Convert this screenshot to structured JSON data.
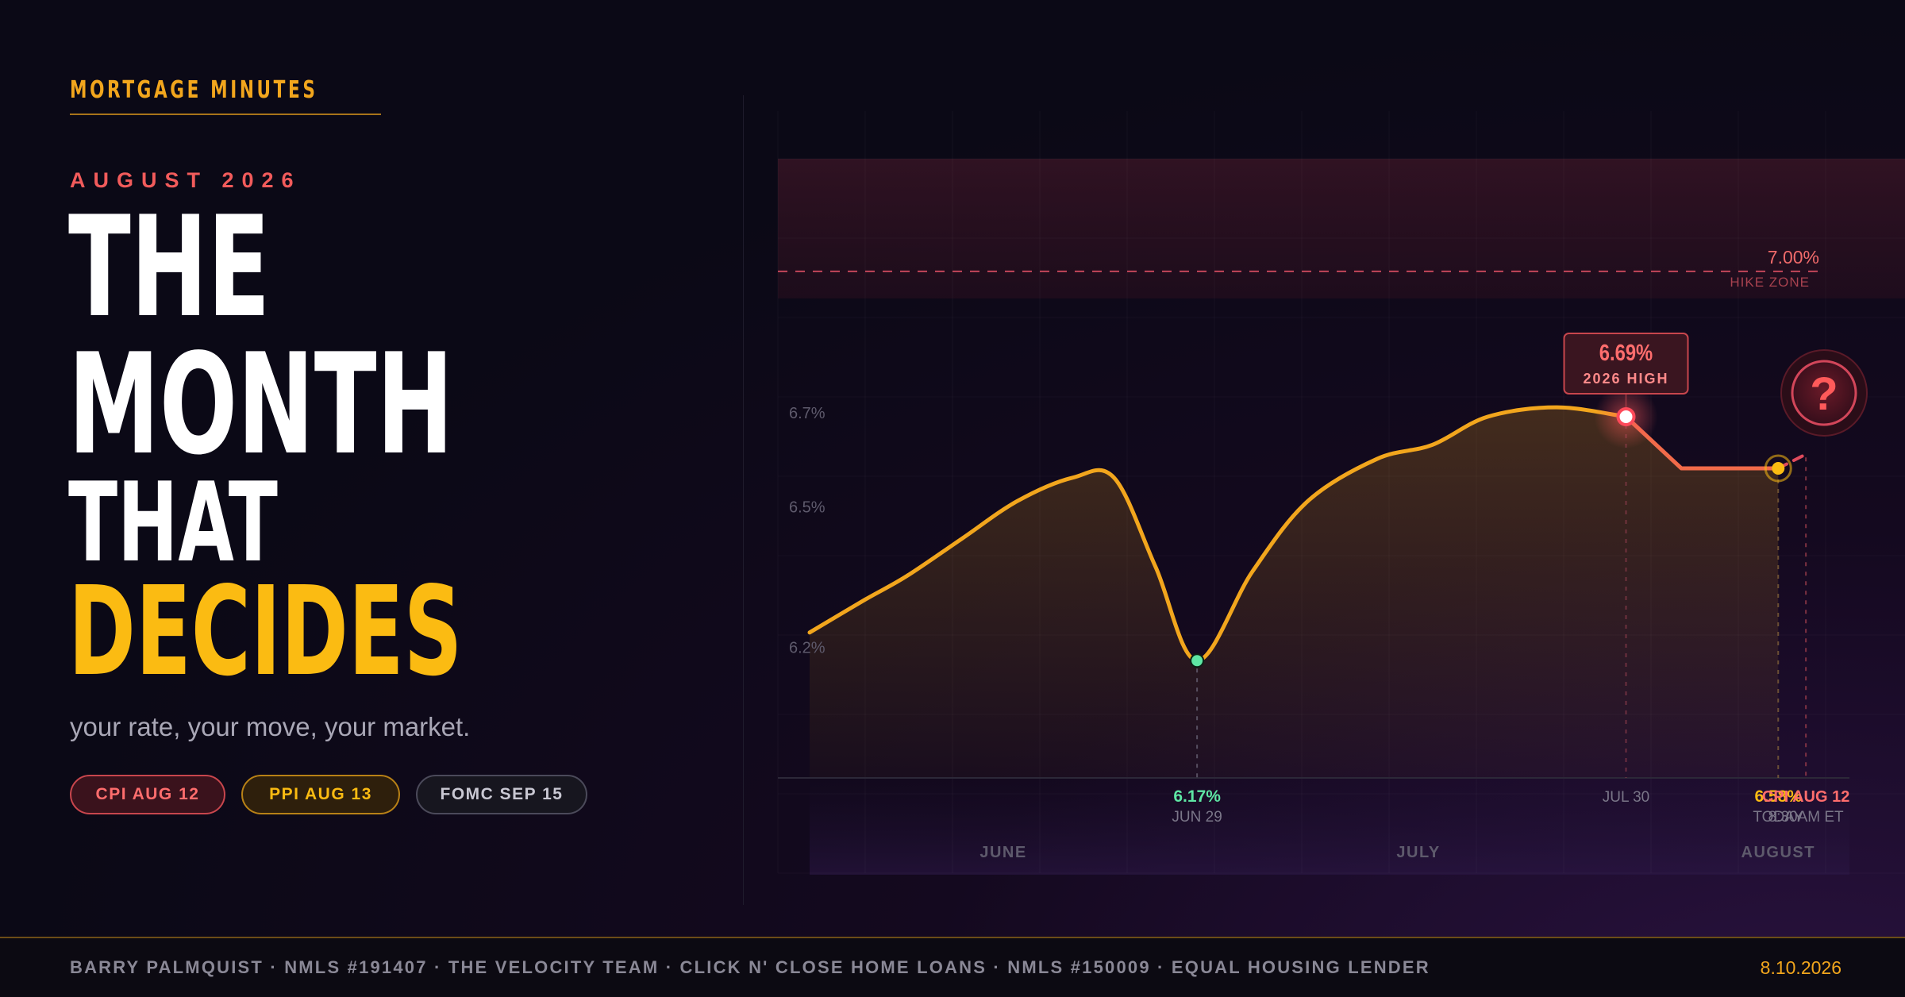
{
  "brand": "MORTGAGE MINUTES",
  "kicker": "AUGUST 2026",
  "headline": {
    "line1": "THE",
    "line2": "MONTH",
    "line3": "THAT",
    "line4": "DECIDES"
  },
  "subtitle": "your rate, your move, your market.",
  "pills": [
    {
      "label": "CPI AUG 12",
      "color": "#ff6d6d"
    },
    {
      "label": "PPI AUG 13",
      "color": "#fbbb12"
    },
    {
      "label": "FOMC SEP 15",
      "color": "#c9c8d3"
    }
  ],
  "footer": {
    "credits": "BARRY PALMQUIST · NMLS #191407 · THE VELOCITY TEAM · CLICK N' CLOSE HOME LOANS · NMLS #150009 · EQUAL HOUSING LENDER",
    "date": "8.10.2026"
  },
  "chart_data": {
    "type": "line",
    "x_range": [
      "2026-06-01",
      "2026-08-14"
    ],
    "y_range": [
      5.92,
      7.24
    ],
    "series": [
      {
        "values": [
          {
            "x": "2026-06-01",
            "y": 6.23
          },
          {
            "x": "2026-06-05",
            "y": 6.3
          },
          {
            "x": "2026-06-08",
            "y": 6.35
          },
          {
            "x": "2026-06-12",
            "y": 6.43
          },
          {
            "x": "2026-06-16",
            "y": 6.51
          },
          {
            "x": "2026-06-20",
            "y": 6.56
          },
          {
            "x": "2026-06-23",
            "y": 6.56
          },
          {
            "x": "2026-06-26",
            "y": 6.37
          },
          {
            "x": "2026-06-29",
            "y": 6.17
          },
          {
            "x": "2026-07-03",
            "y": 6.36
          },
          {
            "x": "2026-07-07",
            "y": 6.51
          },
          {
            "x": "2026-07-12",
            "y": 6.6
          },
          {
            "x": "2026-07-16",
            "y": 6.63
          },
          {
            "x": "2026-07-20",
            "y": 6.69
          },
          {
            "x": "2026-07-25",
            "y": 6.71
          },
          {
            "x": "2026-07-30",
            "y": 6.69
          },
          {
            "x": "2026-08-03",
            "y": 6.58
          },
          {
            "x": "2026-08-10",
            "y": 6.58
          }
        ]
      }
    ],
    "projection": [
      {
        "x": "2026-08-10",
        "y": 6.58
      },
      {
        "x": "2026-08-12",
        "y": 6.61
      }
    ],
    "threshold": {
      "value": 7.0,
      "label": "7.00%",
      "sublabel": "HIKE ZONE"
    },
    "y_ticks": [
      {
        "value": 6.7,
        "label": "6.7%"
      },
      {
        "value": 6.5,
        "label": "6.5%"
      },
      {
        "value": 6.2,
        "label": "6.2%"
      }
    ],
    "month_labels": [
      {
        "x": "2026-06-15",
        "label": "JUNE"
      },
      {
        "x": "2026-07-15",
        "label": "JULY"
      },
      {
        "x": "2026-08-10",
        "label": "AUGUST"
      }
    ],
    "annotations": {
      "low": {
        "x": "2026-06-29",
        "y": 6.17,
        "value_label": "6.17%",
        "date_label": "JUN 29"
      },
      "high": {
        "x": "2026-07-30",
        "y": 6.69,
        "value_label": "6.69%",
        "tag": "2026 HIGH",
        "date_label": "JUL 30"
      },
      "today": {
        "x": "2026-08-10",
        "y": 6.58,
        "value_label": "6.58%",
        "date_label": "TODAY"
      },
      "event": {
        "x": "2026-08-12",
        "title": "CPI AUG 12",
        "time": "8:30AM ET",
        "icon": "question-mark-icon",
        "glyph": "?"
      }
    },
    "colors": {
      "line": "#f2a61d",
      "after_high": "#f26b4a",
      "hike": "#e04a5c",
      "low": "#5ee6a4",
      "today": "#fbbb12"
    },
    "grid": true
  }
}
